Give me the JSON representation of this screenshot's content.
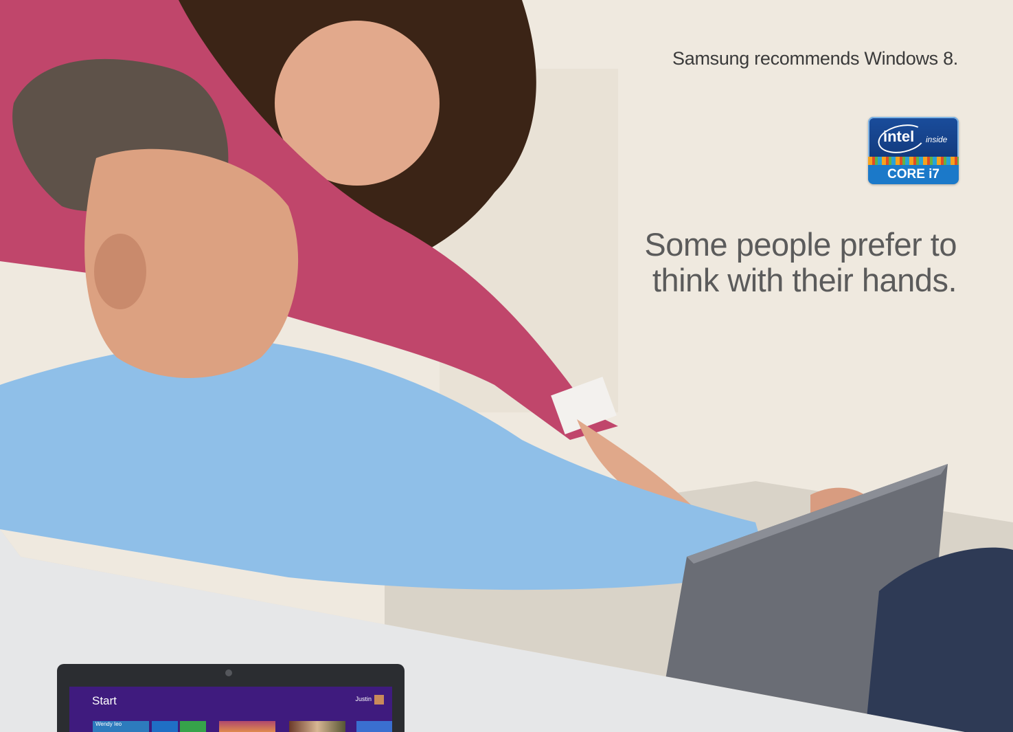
{
  "ad": {
    "tagline": "Samsung recommends Windows 8.",
    "headline_line1": "Some people prefer to",
    "headline_line2": "think with their hands."
  },
  "badge": {
    "brand": "intel",
    "sub": "inside",
    "model": "CORE i7",
    "icon": "intel-core-i7-logo"
  },
  "device_screen": {
    "start_label": "Start",
    "user": "Justin",
    "tile_label": "Wendy Ieo"
  },
  "colors": {
    "start_screen": "#3f1b7e",
    "badge_blue": "#1b79c9",
    "shirt_blue": "#8fbfe8",
    "sweater_pink": "#c0466b",
    "background_gray": "#e6e7e8"
  }
}
